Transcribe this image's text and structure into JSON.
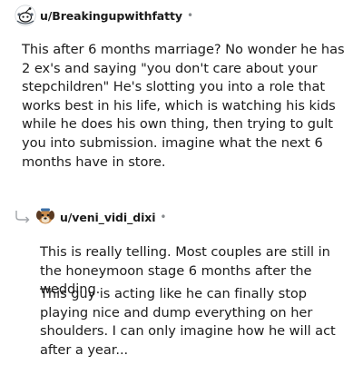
{
  "comments": [
    {
      "username": "u/Breakingupwithfatty",
      "separator": "•",
      "avatar_icon": "snoo-avatar-icon",
      "body": "This after 6 months marriage? No wonder he has 2 ex's and saying \"you don't care about your stepchildren\" He's slotting you into a role that works best in his life, which is watching his kids while he does his own thing, then trying to gult you into submission. imagine what the next 6 months have in store."
    },
    {
      "username": "u/veni_vidi_dixi",
      "separator": "•",
      "avatar_icon": "dog-avatar-icon",
      "reply_icon": "reply-arrow-icon",
      "paragraphs": [
        "This is really telling. Most couples are still in the honeymoon stage 6 months after the wedding.",
        "This guy is acting like he can finally stop playing nice and dump everything on her shoulders. I can only imagine how he will act after a year..."
      ]
    }
  ]
}
